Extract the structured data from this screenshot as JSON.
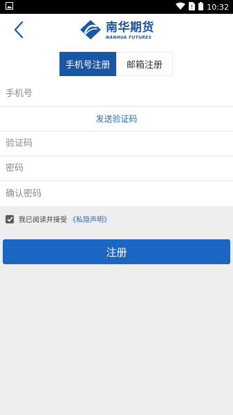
{
  "status_bar": {
    "time": "10:32",
    "icons": [
      "image-icon",
      "wifi-icon",
      "no-sim-icon",
      "battery-icon"
    ]
  },
  "header": {
    "logo_cn": "南华期货",
    "logo_en": "NANHUA FUTURES"
  },
  "tabs": [
    {
      "label": "手机号注册",
      "active": true
    },
    {
      "label": "邮箱注册",
      "active": false
    }
  ],
  "form": {
    "phone_placeholder": "手机号",
    "send_code": "发送验证码",
    "code_placeholder": "验证码",
    "password_placeholder": "密码",
    "confirm_placeholder": "确认密码"
  },
  "agreement": {
    "text": "我已阅读并接受",
    "link": "《私隐声明》",
    "checked": true
  },
  "submit_label": "注册",
  "colors": {
    "brand": "#1a56a8",
    "button": "#1a66c2",
    "link": "#2b6cb8"
  }
}
